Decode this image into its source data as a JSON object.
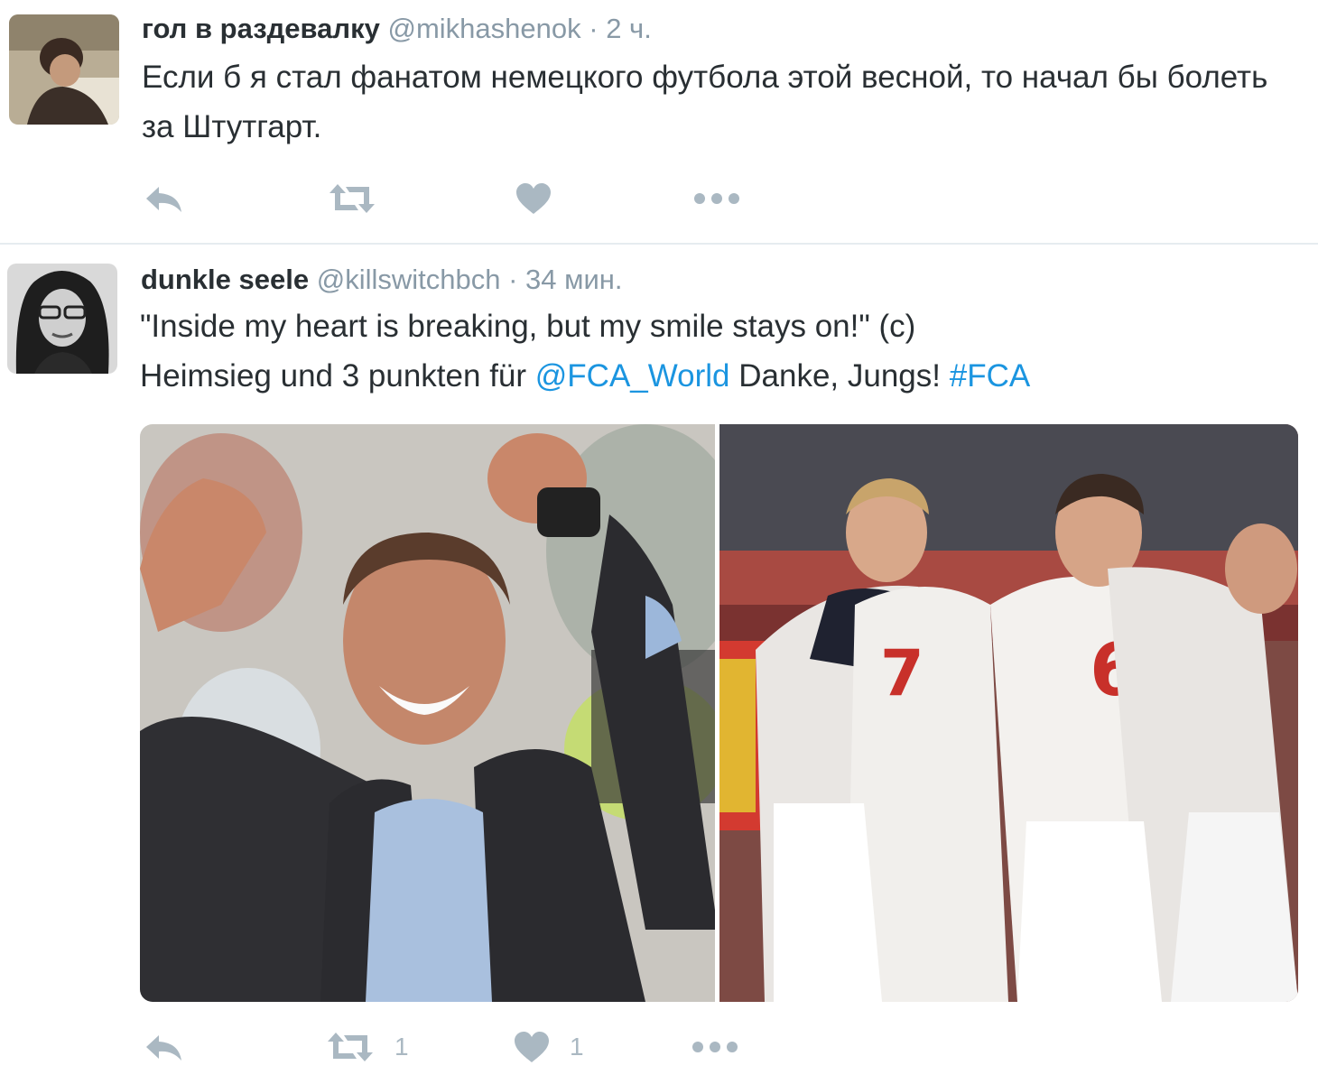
{
  "tweets": [
    {
      "author": {
        "fullname": "гол в раздевалку",
        "username": "@mikhashenok",
        "separator": "·",
        "time": "2 ч.",
        "avatar_icon": "user-avatar-photo"
      },
      "text": [
        {
          "type": "text",
          "value": "Если б я стал фанатом немецкого футбола этой весной, то начал бы болеть за Штутгарт."
        }
      ],
      "actions": {
        "reply_icon": "reply-icon",
        "retweet_icon": "retweet-icon",
        "like_icon": "heart-icon",
        "more_icon": "more-icon",
        "retweet_count": "",
        "like_count": ""
      }
    },
    {
      "author": {
        "fullname": "dunkle seele",
        "username": "@killswitchbch",
        "separator": "·",
        "time": "34 мин.",
        "avatar_icon": "user-avatar-photo"
      },
      "text": {
        "line1": "\"Inside my heart is breaking, but my smile stays on!\" (c)",
        "line2_before": "Heimsieg und 3 punkten für ",
        "mention": "@FCA_World",
        "line2_middle": " Danke, Jungs! ",
        "hashtag": "#FCA"
      },
      "media": {
        "photos": [
          "coach-celebrating-photo",
          "players-huddle-photo"
        ]
      },
      "actions": {
        "reply_icon": "reply-icon",
        "retweet_icon": "retweet-icon",
        "like_icon": "heart-icon",
        "more_icon": "more-icon",
        "retweet_count": "1",
        "like_count": "1"
      }
    }
  ],
  "colors": {
    "text": "#292f33",
    "secondary": "#8899a6",
    "link": "#1b95e0",
    "icon": "#aab8c2",
    "divider": "#e6ecf0"
  }
}
